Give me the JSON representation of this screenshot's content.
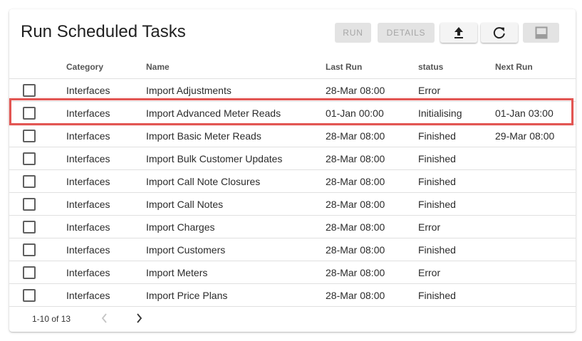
{
  "page": {
    "title": "Run Scheduled Tasks"
  },
  "toolbar": {
    "run_label": "RUN",
    "details_label": "DETAILS",
    "upload_icon": "upload-icon",
    "refresh_icon": "refresh-icon",
    "panel_icon": "bottom-panel-icon"
  },
  "table": {
    "columns": [
      "",
      "Category",
      "Name",
      "Last Run",
      "status",
      "Next Run"
    ],
    "rows": [
      {
        "category": "Interfaces",
        "name": "Import Adjustments",
        "last_run": "28-Mar 08:00",
        "status": "Error",
        "next_run": ""
      },
      {
        "category": "Interfaces",
        "name": "Import Advanced Meter Reads",
        "last_run": "01-Jan 00:00",
        "status": "Initialising",
        "next_run": "01-Jan 03:00"
      },
      {
        "category": "Interfaces",
        "name": "Import Basic Meter Reads",
        "last_run": "28-Mar 08:00",
        "status": "Finished",
        "next_run": "29-Mar 08:00"
      },
      {
        "category": "Interfaces",
        "name": "Import Bulk Customer Updates",
        "last_run": "28-Mar 08:00",
        "status": "Finished",
        "next_run": ""
      },
      {
        "category": "Interfaces",
        "name": "Import Call Note Closures",
        "last_run": "28-Mar 08:00",
        "status": "Finished",
        "next_run": ""
      },
      {
        "category": "Interfaces",
        "name": "Import Call Notes",
        "last_run": "28-Mar 08:00",
        "status": "Finished",
        "next_run": ""
      },
      {
        "category": "Interfaces",
        "name": "Import Charges",
        "last_run": "28-Mar 08:00",
        "status": "Error",
        "next_run": ""
      },
      {
        "category": "Interfaces",
        "name": "Import Customers",
        "last_run": "28-Mar 08:00",
        "status": "Finished",
        "next_run": ""
      },
      {
        "category": "Interfaces",
        "name": "Import Meters",
        "last_run": "28-Mar 08:00",
        "status": "Error",
        "next_run": ""
      },
      {
        "category": "Interfaces",
        "name": "Import Price Plans",
        "last_run": "28-Mar 08:00",
        "status": "Finished",
        "next_run": ""
      }
    ]
  },
  "pagination": {
    "range_label": "1-10 of 13",
    "prev_icon": "chevron-left-icon",
    "next_icon": "chevron-right-icon"
  },
  "colors": {
    "highlight": "#e25552",
    "disabled_button_bg": "#e3e3e3"
  }
}
